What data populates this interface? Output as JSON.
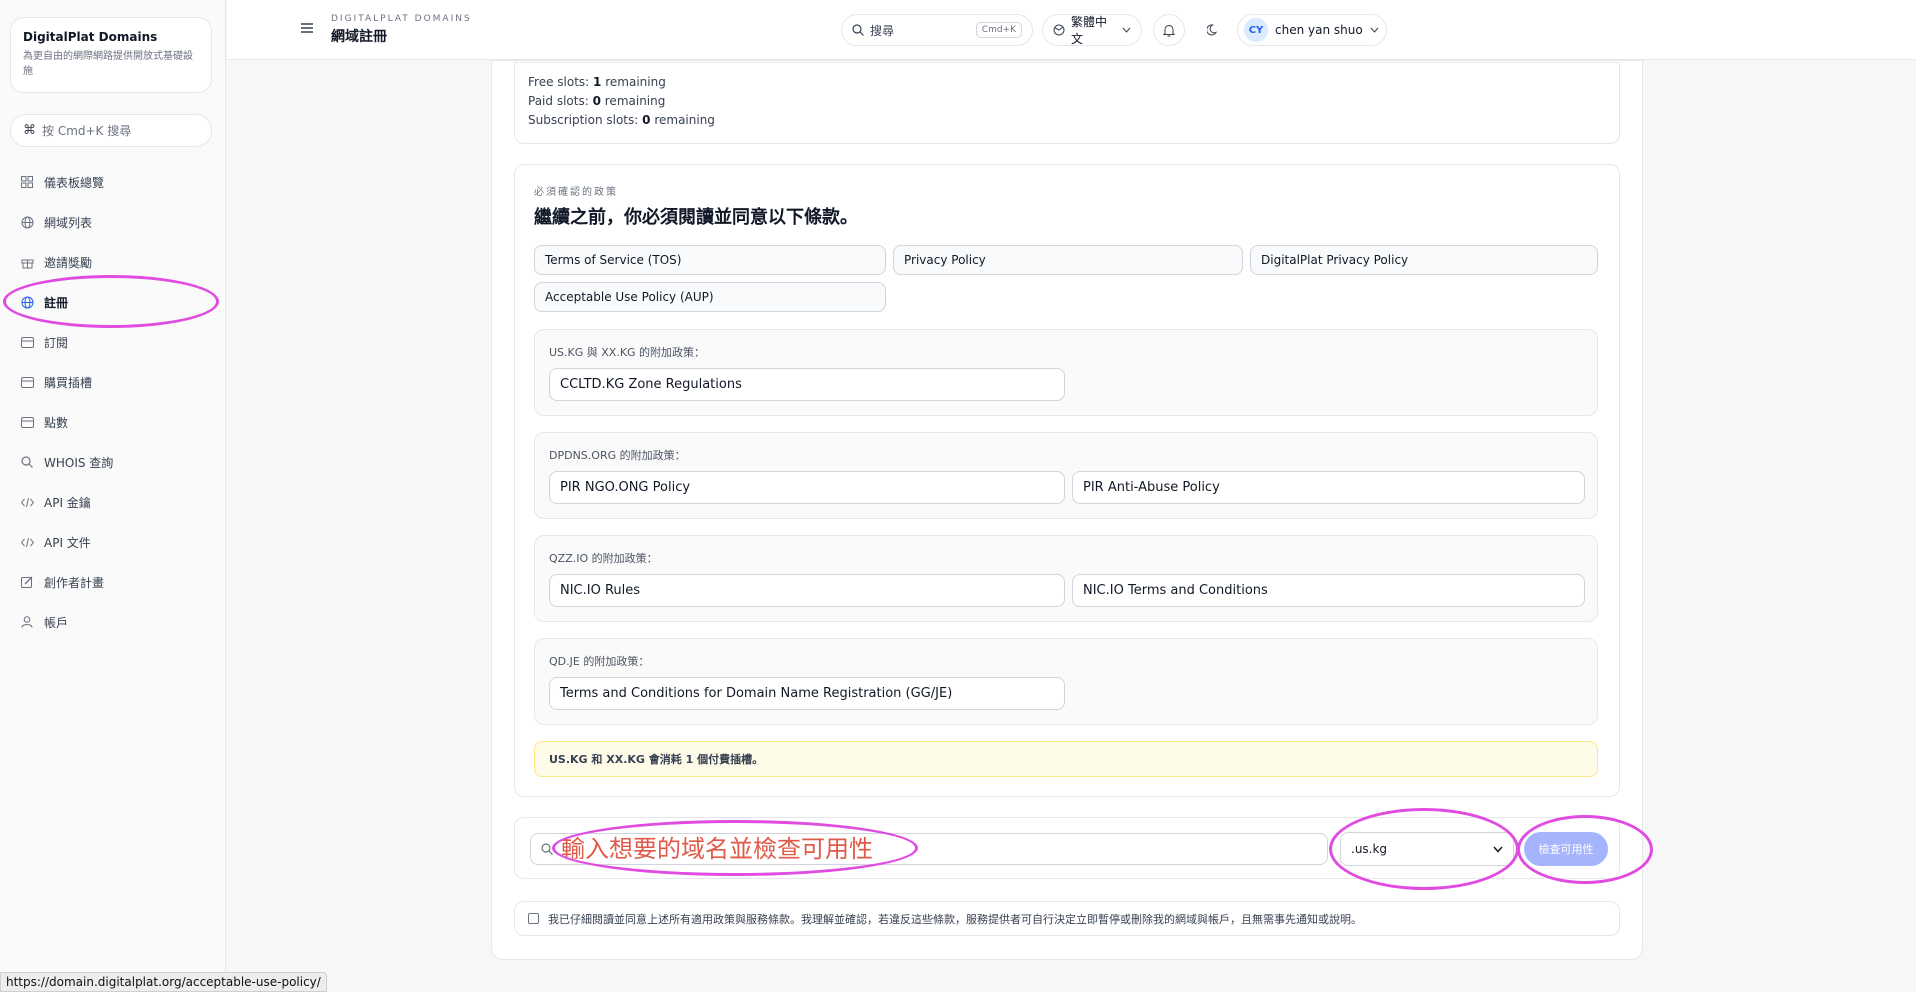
{
  "sidebar": {
    "brand_title": "DigitalPlat Domains",
    "brand_sub": "為更自由的網際網路提供開放式基礎設施",
    "search_label": "按 Cmd+K 搜尋",
    "items": [
      {
        "label": "儀表板總覽",
        "icon": "dashboard-icon"
      },
      {
        "label": "網域列表",
        "icon": "globe-icon"
      },
      {
        "label": "邀請獎勵",
        "icon": "gift-icon"
      },
      {
        "label": "註冊",
        "icon": "globe-icon"
      },
      {
        "label": "訂閱",
        "icon": "card-icon"
      },
      {
        "label": "購買插槽",
        "icon": "card-icon"
      },
      {
        "label": "點數",
        "icon": "card-icon"
      },
      {
        "label": "WHOIS 查詢",
        "icon": "search-icon"
      },
      {
        "label": "API 金鑰",
        "icon": "code-icon"
      },
      {
        "label": "API 文件",
        "icon": "code-icon"
      },
      {
        "label": "創作者計畫",
        "icon": "edit-icon"
      },
      {
        "label": "帳戶",
        "icon": "user-icon"
      }
    ],
    "active_index": 3
  },
  "topbar": {
    "crumb_small": "DIGITALPLAT DOMAINS",
    "crumb_title": "網域註冊",
    "search_label": "搜尋",
    "search_kbd": "Cmd+K",
    "language": "繁體中文",
    "user_initials": "CY",
    "user_name": "chen yan shuo"
  },
  "slots": {
    "free_label": "Free slots:",
    "free_count": "1",
    "paid_label": "Paid slots:",
    "paid_count": "0",
    "sub_label": "Subscription slots:",
    "sub_count": "0",
    "suffix": "remaining"
  },
  "policies": {
    "small_label": "必須確認的政策",
    "title": "繼續之前，你必須閱讀並同意以下條款。",
    "main": [
      "Terms of Service (TOS)",
      "Privacy Policy",
      "DigitalPlat Privacy Policy",
      "Acceptable Use Policy (AUP)"
    ],
    "groups": [
      {
        "label": "US.KG 與 XX.KG 的附加政策：",
        "items": [
          "CCLTD.KG Zone Regulations"
        ]
      },
      {
        "label": "DPDNS.ORG 的附加政策：",
        "items": [
          "PIR NGO.ONG Policy",
          "PIR Anti-Abuse Policy"
        ]
      },
      {
        "label": "QZZ.IO 的附加政策：",
        "items": [
          "NIC.IO Rules",
          "NIC.IO Terms and Conditions"
        ]
      },
      {
        "label": "QD.JE 的附加政策：",
        "items": [
          "Terms and Conditions for Domain Name Registration (GG/JE)"
        ]
      }
    ],
    "notice": "US.KG 和 XX.KG 會消耗 1 個付費插槽。"
  },
  "domain_search": {
    "placeholder": "輸入想要的域名並檢查可用性",
    "tld": ".us.kg",
    "check_label": "檢查可用性"
  },
  "agreement": "我已仔細閱讀並同意上述所有適用政策與服務條款。我理解並確認，若違反這些條款，服務提供者可自行決定立即暫停或刪除我的網域與帳戶，且無需事先通知或說明。",
  "status_url": "https://domain.digitalplat.org/acceptable-use-policy/",
  "colors": {
    "accent": "#2563eb",
    "annotation": "#e04be0",
    "button": "#a5b4fc"
  }
}
